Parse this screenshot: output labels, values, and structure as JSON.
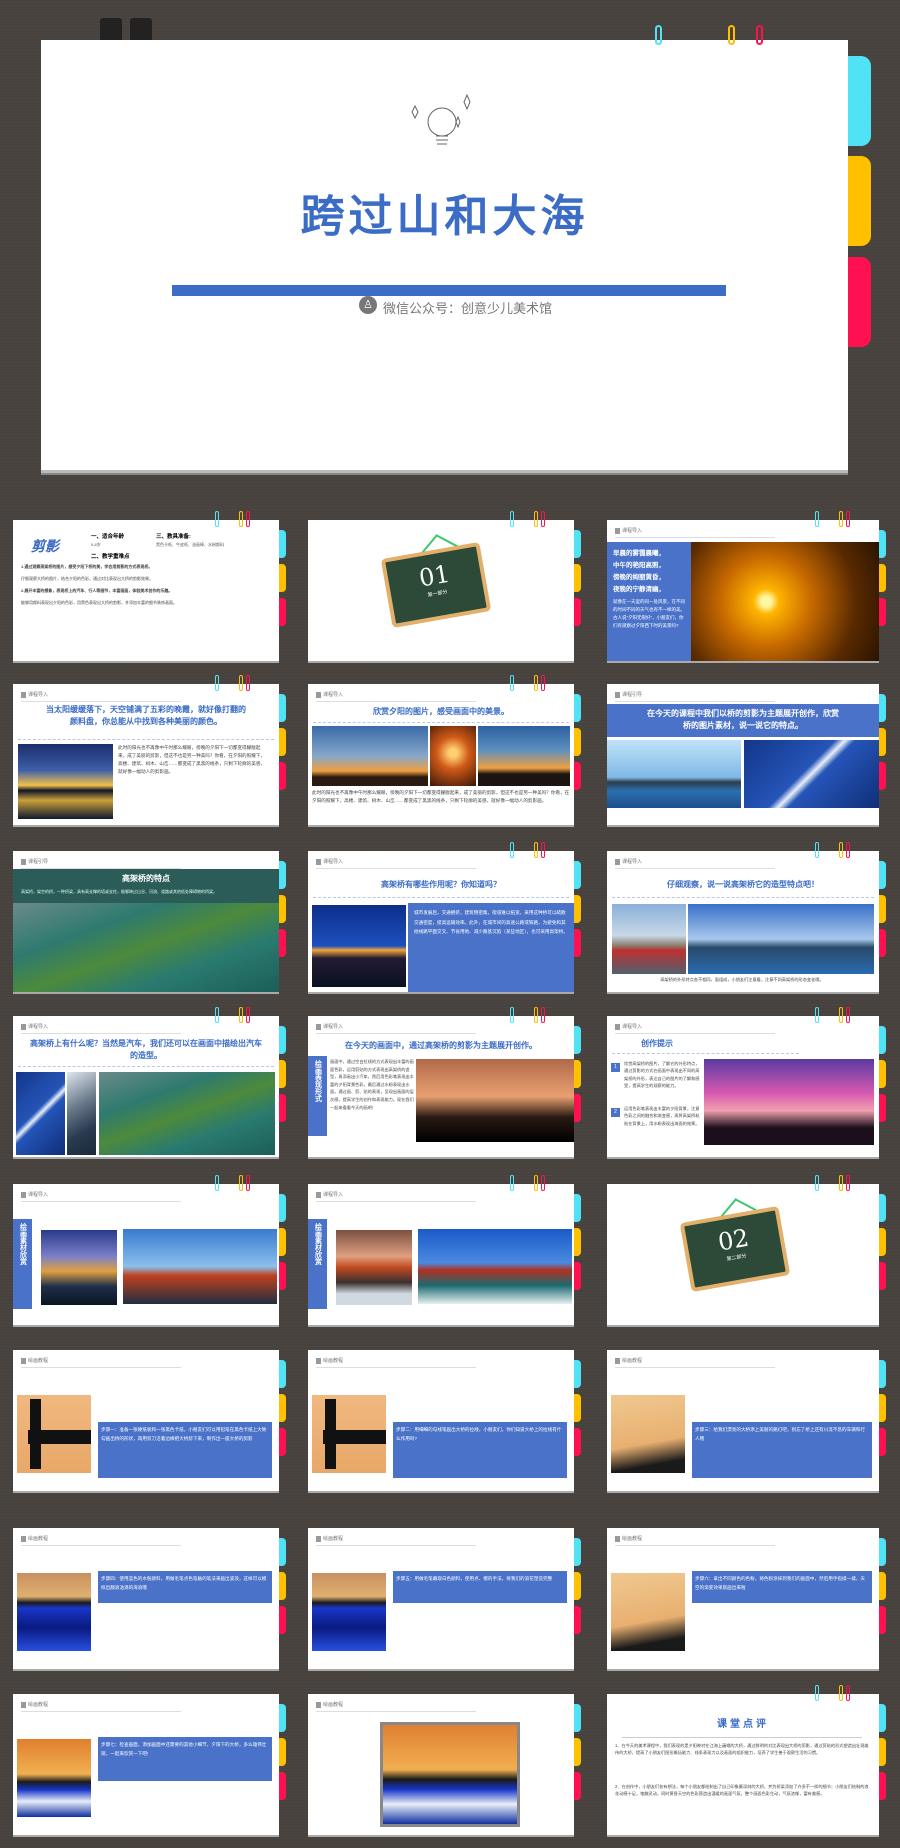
{
  "colors": {
    "accent": "#3b6cc6",
    "tab_cyan": "#4fe3f5",
    "tab_yellow": "#ffc000",
    "tab_red": "#ff1050",
    "background": "#47423e"
  },
  "cover": {
    "title": "跨过山和大海",
    "subtitle": "微信公众号：创意少儿美术馆",
    "icons": [
      "binder-clip-icon",
      "lightbulb-icon",
      "sparkle-icon",
      "paperclip-icon",
      "user-icon"
    ]
  },
  "slides": [
    {
      "layout": "intro",
      "logo": "剪影",
      "h1": "一、适合年龄",
      "h1_sub": "5-8岁",
      "h3": "三、教具准备:",
      "h3_sub": "黑色卡纸、牛皮纸、油画棒、水粉颜料",
      "h2": "二、教学重难点",
      "p1": "1.通过观察高架桥的图片，感受夕阳下桥的美，学会用剪影的方式表现桥。",
      "p1b": "仔细观察大桥的图片，结合夕阳的色彩，通过对比表现出大桥的剪影效果。",
      "p2": "2.展开丰富的想象，表现桥上的汽车、行人等细节，丰富画面，体验美术创作的乐趣。",
      "p2b": "能够用颜料表现出夕阳的色彩，用黑色表现出大桥的剪影，并添加丰富的细节装饰画面。"
    },
    {
      "layout": "section",
      "num": "01",
      "label": "第一部分"
    },
    {
      "layout": "left-panel",
      "header": "课程导入",
      "lines": [
        "早晨的雾霭晨曦，",
        "中午的艳阳高照，",
        "傍晚的绚丽黄昏，",
        "夜晚的宁静清幽，"
      ],
      "body": "就像在一天里的同一处风景，在不同的时间不同的天气也有不一样的美。古人说“夕阳无限好”，小朋友们，你们有观察过夕阳西下时的美景吗?",
      "images": [
        "sunset"
      ]
    },
    {
      "layout": "title-img-text",
      "header": "课程导入",
      "title": "当太阳缓缓落下，天空铺满了五彩的晚霞，就好像打翻的颜料盘，你总能从中找到各种美丽的颜色。",
      "body": "此时的阳光也不再像中午时那么耀眼，傍晚的夕阳下一切都变得朦胧起来，成了美丽的剪影，但这不也是另一种美吗？你看，在夕阳的照耀下，高楼、建筑、树木、山峦……都变成了黑黑的线条，只剩下轮廓的美感，就好像一幅动人的剪影画。",
      "images": [
        "sunset-sky"
      ]
    },
    {
      "layout": "title-3img-text",
      "header": "课程导入",
      "title": "欣赏夕阳的图片，感受画面中的美景。",
      "body": "此时的阳光也不再像中午时那么耀眼，傍晚的夕阳下一切都变得朦胧起来，成了美丽的剪影，但这不也是另一种美吗？你看，在夕阳的照耀下，高楼、建筑、树木、山峦……都变成了黑黑的线条，只剩下轮廓的美感，就好像一幅动人的剪影画。",
      "images": [
        "dusk",
        "dandelion",
        "family"
      ]
    },
    {
      "layout": "banner-2img",
      "header": "课程引导",
      "title": "在今天的课程中我们以桥的剪影为主题展开创作，欣赏桥的图片素材，说一说它的特点。",
      "images": [
        "sydney",
        "aerial-blue"
      ]
    },
    {
      "layout": "green-banner",
      "header": "课程引导",
      "title": "高架桥的特点",
      "body": "高架桥，架空的桥，一种桥梁，具有高支撑的塔或支柱，能够跨过山谷、河流、道路或其他低处障碍物的桥梁。",
      "images": [
        "island"
      ]
    },
    {
      "layout": "title-img-panel",
      "header": "课程导入",
      "title": "高架桥有哪些作用呢？你知道吗？",
      "body": "城市发展后，交通拥挤，建筑物密集，街道难以拓宽，采用这种桥可以疏散交通密度，提高运输效率。此外，在城市间的高速公路或铁路，为避免和其他线路平面交叉、节省用地、减少路基沉陷（某些地区），也可采用高架桥。",
      "images": [
        "nightbridge"
      ]
    },
    {
      "layout": "title-2img-caption",
      "header": "课程导入",
      "title": "仔细观察，说一说高架桥它的造型特点吧！",
      "caption": "高架桥的外形特点各不相同，面组成，小朋友们注意看，注意不同高架桥的形态变化哦。",
      "images": [
        "cable",
        "cable2"
      ]
    },
    {
      "layout": "title-3img",
      "header": "课程导入",
      "title": "高架桥上有什么呢？当然是汽车，我们还可以在画面中描绘出汽车的造型。",
      "images": [
        "aerial-blue",
        "highway",
        "island"
      ]
    },
    {
      "layout": "side-text",
      "header": "课程导入",
      "side": "绘画表现形式",
      "title": "在今天的画面中，通过高架桥的剪影为主题展开创作。",
      "body": "画面中，通过空白拉线的方式表现出丰富的画面色彩，运用剪贴的方式表现出高架桥的造型，再添画出小汽车，然后用色彩笔表现出丰富的夕阳背景色彩，最后通过水粉表现出水面。通过画、剪、贴的表现，呈现出画面的层次感，提高学生的创作和表现能力。现在我们一起来看看今天的画吧!",
      "images": [
        "arch"
      ]
    },
    {
      "layout": "tips",
      "header": "课程导入",
      "title": "创作提示",
      "tips": [
        {
          "n": "1",
          "text": "欣赏高架桥的图片，了解它的外形特点，通过剪影的方式在画面中表现出不同的高架桥的外形，表达自己的图片的了解和感受，提高学生的观察的能力。"
        },
        {
          "n": "2",
          "text": "运用色彩笔表现出丰富的夕阳背景，注意色彩之间的融合和渐变感，再将高架桥粘贴在背景上，用水粉表现出海面的效果。"
        }
      ],
      "images": [
        "pinkbridge"
      ]
    },
    {
      "layout": "side-img",
      "header": "课程导入",
      "side": "绘画素材欣赏",
      "images": [
        "gg-night",
        "gg-day"
      ]
    },
    {
      "layout": "side-img",
      "header": "课程导入",
      "side": "绘画素材欣赏",
      "images": [
        "gg-waves",
        "gg-waves2"
      ]
    },
    {
      "layout": "section",
      "num": "02",
      "label": "第二部分"
    },
    {
      "layout": "step",
      "header": "绘画教程",
      "body": "步骤一：准备一张硬纸板和一张黑色卡纸，小朋友们可以用铅笔在黑色卡纸上大致勾画出桥的形状，再用剪刀沿着边缘把大桥剪下来，制作出一座大桥的剪影",
      "images": [
        "craft"
      ]
    },
    {
      "layout": "step",
      "header": "绘画教程",
      "body": "步骤二：用细细的勾线笔画出大桥的拉线，小朋友们，你们知道大桥上的拉线有什么作用吗?",
      "images": [
        "craft"
      ]
    },
    {
      "layout": "step",
      "header": "绘画教程",
      "body": "步骤三：给我们漂亮的大桥添上美丽的路灯吧，别忘了桥上还有川流不息的车辆和行人哦",
      "images": [
        "paper"
      ]
    },
    {
      "layout": "step",
      "header": "绘画教程",
      "body": "步骤四：使用蓝色的水粉颜料，用做毛笔点色笔触的笔法来画出波浪，这样可以模拟出翻滚汹涌的海浪哦",
      "images": [
        "paint"
      ]
    },
    {
      "layout": "step",
      "header": "绘画教程",
      "body": "步骤五：用做毛笔蘸取白色颜料，使用点、擦的手法，将我们的浪花塑造完整",
      "images": [
        "paint"
      ]
    },
    {
      "layout": "step",
      "header": "绘画教程",
      "body": "步骤六：拿出不同颜色的色粉，将色粉涂抹到我们的画面中，然后用手指揉一揉，天空的渐变效果就画出来啦",
      "images": [
        "paper"
      ]
    },
    {
      "layout": "step",
      "header": "绘画教程",
      "body": "步骤七：检查画面，添加画面中还需要的其他小细节，夕阳下的大桥，多么雄伟壮观，一起来欣赏一下吧!",
      "images": [
        "paint-sky"
      ]
    },
    {
      "layout": "framed",
      "header": "绘画教程",
      "images": [
        "paint-sky"
      ]
    },
    {
      "layout": "review",
      "title": "课堂点评",
      "p1": "1、在今天的美术课程中，我们表现的是夕阳映衬在江海上巍峨的大桥，通过鲜明的对比表现出大桥的剪影，通过剪贴的形式塑造出壮观雄伟的大桥，提高了小朋友们图形概括能力、线条表现力以及画面的组织能力，培养了学生善于观察生活的习惯。",
      "p2": "2、在创作中，小朋友们各有想法，每个小朋友都绘制出了自己印象最深刻的大桥，并为桥梁添加了许多不一样的细节；小朋友们绘制的浪花动感十足，笔触灵动，同时黄昏天空的色彩营造出温暖的画面气氛，整个画面色彩生动，气氛浓郁，富有美感。"
    }
  ]
}
